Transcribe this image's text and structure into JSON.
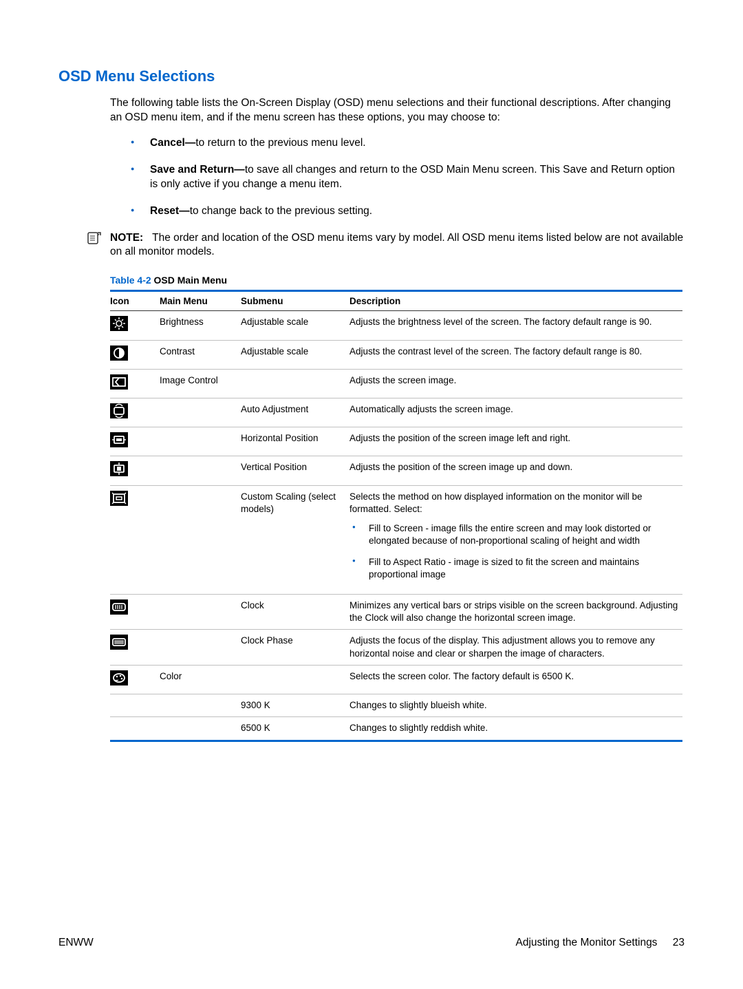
{
  "heading": "OSD Menu Selections",
  "intro": "The following table lists the On-Screen Display (OSD) menu selections and their functional descriptions. After changing an OSD menu item, and if the menu screen has these options, you may choose to:",
  "options": [
    {
      "bold": "Cancel—",
      "rest": "to return to the previous menu level."
    },
    {
      "bold": "Save and Return—",
      "rest": "to save all changes and return to the OSD Main Menu screen. This Save and Return option is only active if you change a menu item."
    },
    {
      "bold": "Reset—",
      "rest": "to change back to the previous setting."
    }
  ],
  "note": {
    "label": "NOTE:",
    "text": "The order and location of the OSD menu items vary by model. All OSD menu items listed below are not available on all monitor models."
  },
  "table_title_prefix": "Table 4-2",
  "table_title_rest": "  OSD Main Menu",
  "columns": {
    "icon": "Icon",
    "main": "Main Menu",
    "sub": "Submenu",
    "desc": "Description"
  },
  "rows": [
    {
      "icon": "brightness-icon",
      "main": "Brightness",
      "sub": "Adjustable scale",
      "desc": "Adjusts the brightness level of the screen. The factory default range is 90."
    },
    {
      "icon": "contrast-icon",
      "main": "Contrast",
      "sub": "Adjustable scale",
      "desc": "Adjusts the contrast level of the screen. The factory default range is 80."
    },
    {
      "icon": "image-control-icon",
      "main": "Image Control",
      "sub": "",
      "desc": "Adjusts the screen image."
    },
    {
      "icon": "auto-adjust-icon",
      "main": "",
      "sub": "Auto Adjustment",
      "desc": "Automatically adjusts the screen image."
    },
    {
      "icon": "horizontal-position-icon",
      "main": "",
      "sub": "Horizontal Position",
      "desc": "Adjusts the position of the screen image left and right."
    },
    {
      "icon": "vertical-position-icon",
      "main": "",
      "sub": "Vertical Position",
      "desc": "Adjusts the position of the screen image up and down."
    },
    {
      "icon": "custom-scaling-icon",
      "main": "",
      "sub": "Custom Scaling (select models)",
      "desc": "Selects the method on how displayed information on the monitor will be formatted. Select:",
      "sub_items": [
        "Fill to Screen - image fills the entire screen and may look distorted or elongated because of non-proportional scaling of height and width",
        "Fill to Aspect Ratio - image is sized to fit the screen and maintains proportional image"
      ]
    },
    {
      "icon": "clock-icon",
      "main": "",
      "sub": "Clock",
      "desc": "Minimizes any vertical bars or strips visible on the screen background. Adjusting the Clock will also change the horizontal screen image."
    },
    {
      "icon": "clock-phase-icon",
      "main": "",
      "sub": "Clock Phase",
      "desc": "Adjusts the focus of the display. This adjustment allows you to remove any horizontal noise and clear or sharpen the image of characters."
    },
    {
      "icon": "color-icon",
      "main": "Color",
      "sub": "",
      "desc": "Selects the screen color. The factory default is 6500 K."
    },
    {
      "icon": "",
      "main": "",
      "sub": "9300 K",
      "desc": "Changes to slightly blueish white."
    },
    {
      "icon": "",
      "main": "",
      "sub": "6500 K",
      "desc": "Changes to slightly reddish white."
    }
  ],
  "footer": {
    "left": "ENWW",
    "right_text": "Adjusting the Monitor Settings",
    "page": "23"
  }
}
